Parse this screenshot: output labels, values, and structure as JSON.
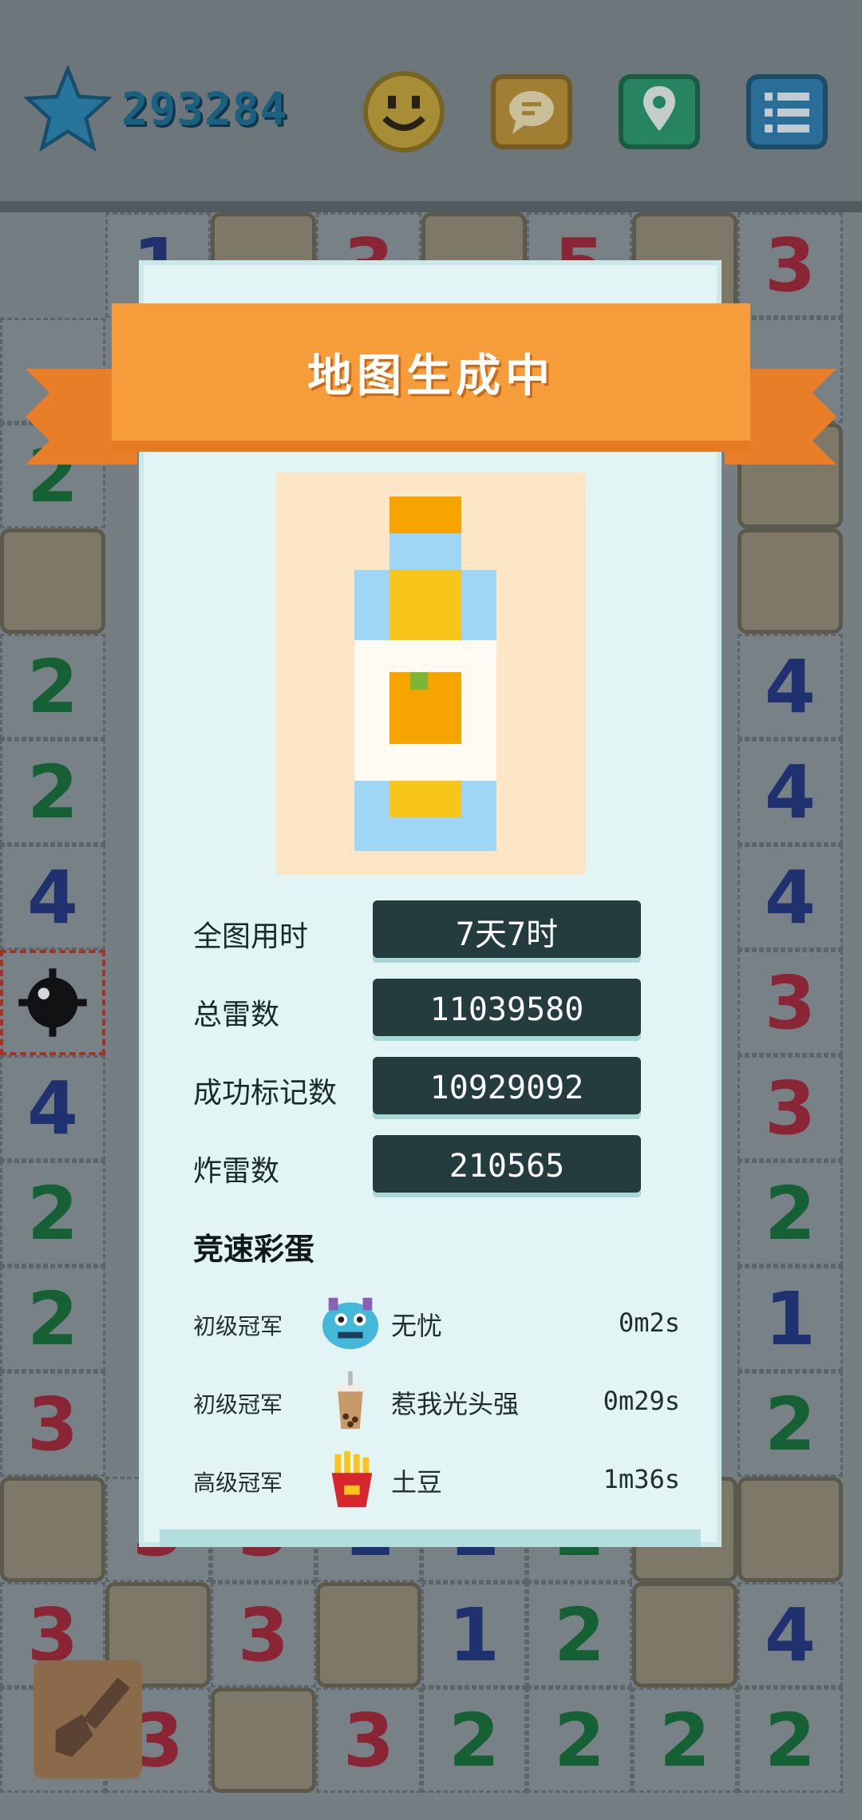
{
  "header": {
    "score": "293284",
    "buttons": [
      {
        "icon": "smiley-icon",
        "color": "#c7a63a"
      },
      {
        "icon": "chat-icon",
        "color": "#bf9536"
      },
      {
        "icon": "location-pin-icon",
        "color": "#2b9c6e"
      },
      {
        "icon": "menu-list-icon",
        "color": "#2f7fb0"
      }
    ]
  },
  "dialog": {
    "title": "地图生成中",
    "stats": [
      {
        "label": "全图用时",
        "value": "7天7时"
      },
      {
        "label": "总雷数",
        "value": "11039580"
      },
      {
        "label": "成功标记数",
        "value": "10929092"
      },
      {
        "label": "炸雷数",
        "value": "210565"
      }
    ],
    "speedrun_title": "竞速彩蛋",
    "speedrun": [
      {
        "rank": "初级冠军",
        "avatar": "blue-monster-avatar",
        "name": "无忧",
        "time": "0m2s"
      },
      {
        "rank": "初级冠军",
        "avatar": "bubble-tea-avatar",
        "name": "惹我光头强",
        "time": "0m29s"
      },
      {
        "rank": "高级冠军",
        "avatar": "fries-avatar",
        "name": "土豆",
        "time": "1m36s"
      }
    ]
  },
  "board": {
    "visible_numbers": [
      {
        "v": "1",
        "c": "n1"
      },
      {
        "v": "3",
        "c": "n3"
      },
      {
        "v": "5",
        "c": "n3"
      },
      {
        "v": "3",
        "c": "n3"
      },
      {
        "v": "2",
        "c": "n2"
      },
      {
        "v": "4",
        "c": "n4"
      },
      {
        "v": "2",
        "c": "n2"
      },
      {
        "v": "4",
        "c": "n4"
      },
      {
        "v": "4",
        "c": "n4"
      },
      {
        "v": "4",
        "c": "n4"
      },
      {
        "v": "3",
        "c": "n3"
      },
      {
        "v": "4",
        "c": "n4"
      },
      {
        "v": "3",
        "c": "n3"
      },
      {
        "v": "2",
        "c": "n2"
      },
      {
        "v": "2",
        "c": "n2"
      },
      {
        "v": "2",
        "c": "n2"
      },
      {
        "v": "1",
        "c": "n1"
      },
      {
        "v": "3",
        "c": "n3"
      },
      {
        "v": "2",
        "c": "n2"
      }
    ]
  }
}
